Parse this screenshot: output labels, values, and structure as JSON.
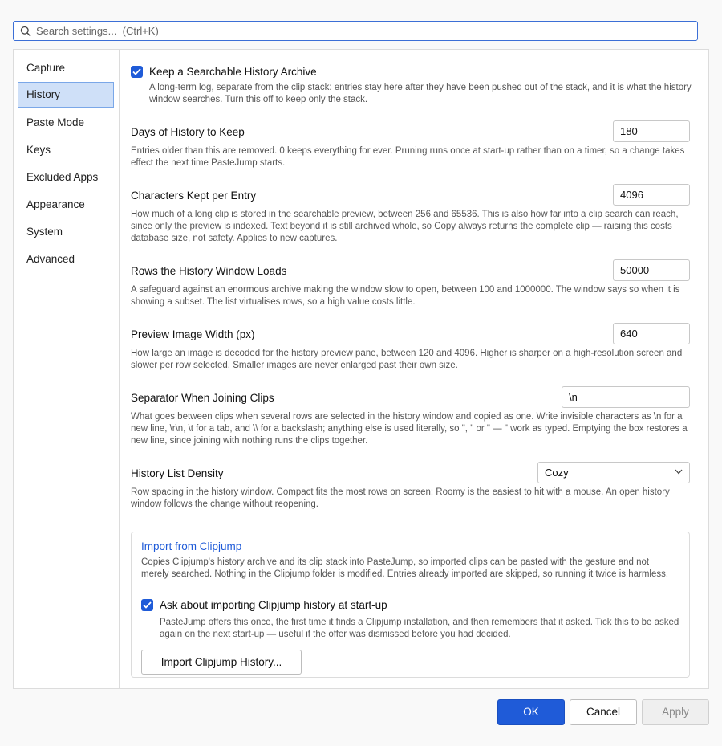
{
  "search": {
    "placeholder": "Search settings...  (Ctrl+K)",
    "value": ""
  },
  "sidebar": {
    "items": [
      {
        "label": "Capture"
      },
      {
        "label": "History"
      },
      {
        "label": "Paste Mode"
      },
      {
        "label": "Keys"
      },
      {
        "label": "Excluded Apps"
      },
      {
        "label": "Appearance"
      },
      {
        "label": "System"
      },
      {
        "label": "Advanced"
      }
    ],
    "active": "History"
  },
  "history": {
    "archive": {
      "checked": true,
      "label": "Keep a Searchable History Archive",
      "desc": "A long-term log, separate from the clip stack: entries stay here after they have been pushed out of the stack, and it is what the history window searches. Turn this off to keep only the stack."
    },
    "days": {
      "title": "Days of History to Keep",
      "value": "180",
      "desc": "Entries older than this are removed. 0 keeps everything for ever. Pruning runs once at start-up rather than on a timer, so a change takes effect the next time PasteJump starts."
    },
    "chars": {
      "title": "Characters Kept per Entry",
      "value": "4096",
      "desc": "How much of a long clip is stored in the searchable preview, between 256 and 65536. This is also how far into a clip search can reach, since only the preview is indexed. Text beyond it is still archived whole, so Copy always returns the complete clip — raising this costs database size, not safety. Applies to new captures."
    },
    "rows": {
      "title": "Rows the History Window Loads",
      "value": "50000",
      "desc": "A safeguard against an enormous archive making the window slow to open, between 100 and 1000000. The window says so when it is showing a subset. The list virtualises rows, so a high value costs little."
    },
    "image_width": {
      "title": "Preview Image Width (px)",
      "value": "640",
      "desc": "How large an image is decoded for the history preview pane, between 120 and 4096. Higher is sharper on a high-resolution screen and slower per row selected. Smaller images are never enlarged past their own size."
    },
    "separator": {
      "title": "Separator When Joining Clips",
      "value": "\\n",
      "desc": "What goes between clips when several rows are selected in the history window and copied as one. Write invisible characters as \\n for a new line, \\r\\n, \\t for a tab, and \\\\ for a backslash; anything else is used literally, so \", \" or \" — \" work as typed. Emptying the box restores a new line, since joining with nothing runs the clips together."
    },
    "density": {
      "title": "History List Density",
      "value": "Cozy",
      "desc": "Row spacing in the history window. Compact fits the most rows on screen; Roomy is the easiest to hit with a mouse. An open history window follows the change without reopening."
    },
    "import": {
      "title": "Import from Clipjump",
      "desc": "Copies Clipjump's history archive and its clip stack into PasteJump, so imported clips can be pasted with the gesture and not merely searched. Nothing in the Clipjump folder is modified. Entries already imported are skipped, so running it twice is harmless.",
      "ask_checked": true,
      "ask_label": "Ask about importing Clipjump history at start-up",
      "ask_desc": "PasteJump offers this once, the first time it finds a Clipjump installation, and then remembers that it asked. Tick this to be asked again on the next start-up — useful if the offer was dismissed before you had decided.",
      "button": "Import Clipjump History..."
    }
  },
  "footer": {
    "ok": "OK",
    "cancel": "Cancel",
    "apply": "Apply"
  },
  "colors": {
    "accent": "#1f5bd8",
    "selected_bg": "#cfe0f8"
  },
  "icons": {
    "search": "search-icon",
    "check": "check-icon",
    "chevron": "chevron-down-icon"
  }
}
